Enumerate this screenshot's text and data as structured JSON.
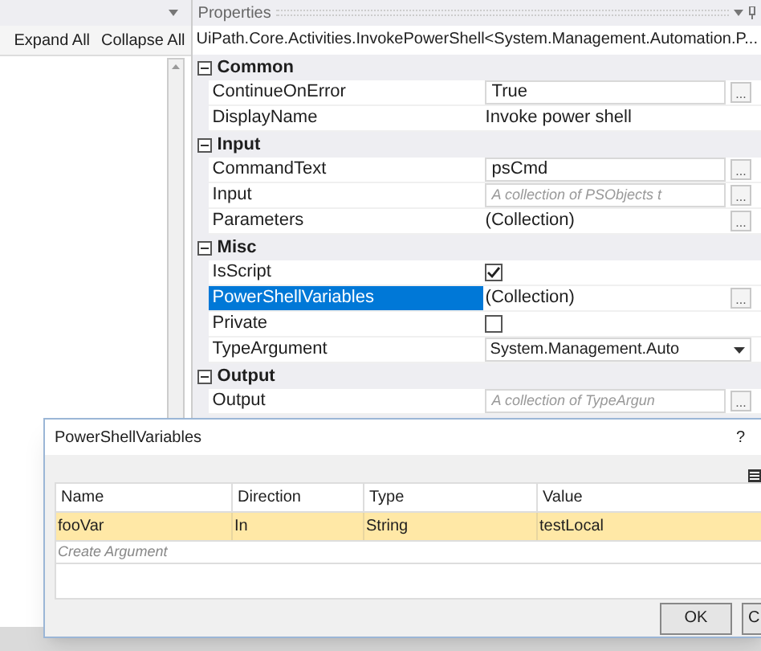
{
  "outline": {
    "actions": [
      "Expand All",
      "Collapse All"
    ]
  },
  "properties": {
    "title": "Properties",
    "type_name": "UiPath.Core.Activities.InvokePowerShell<System.Management.Automation.P...",
    "groups": [
      {
        "name": "Common",
        "rows": [
          {
            "name": "ContinueOnError",
            "kind": "text",
            "value": "True",
            "button": "...",
            "selected": false
          },
          {
            "name": "DisplayName",
            "kind": "plain",
            "value": "Invoke power shell",
            "selected": false
          }
        ]
      },
      {
        "name": "Input",
        "rows": [
          {
            "name": "CommandText",
            "kind": "text",
            "value": "psCmd",
            "button": "...",
            "selected": false
          },
          {
            "name": "Input",
            "kind": "placeholder",
            "placeholder": "A collection of PSObjects t",
            "button": "...",
            "selected": false
          },
          {
            "name": "Parameters",
            "kind": "plain",
            "value": "(Collection)",
            "button": "...",
            "selected": false
          }
        ]
      },
      {
        "name": "Misc",
        "rows": [
          {
            "name": "IsScript",
            "kind": "check",
            "checked": true,
            "selected": false
          },
          {
            "name": "PowerShellVariables",
            "kind": "plain",
            "value": "(Collection)",
            "button": "...",
            "selected": true
          },
          {
            "name": "Private",
            "kind": "check",
            "checked": false,
            "selected": false
          },
          {
            "name": "TypeArgument",
            "kind": "dropdown",
            "value": "System.Management.Auto",
            "selected": false
          }
        ]
      },
      {
        "name": "Output",
        "rows": [
          {
            "name": "Output",
            "kind": "placeholder",
            "placeholder": "A collection of TypeArgun",
            "button": "...",
            "selected": false
          }
        ]
      }
    ]
  },
  "dialog": {
    "title": "PowerShellVariables",
    "help": "?",
    "columns": [
      "Name",
      "Direction",
      "Type",
      "Value"
    ],
    "rows": [
      {
        "cells": [
          "fooVar",
          "In",
          "String",
          "testLocal"
        ],
        "selected": true
      }
    ],
    "create_placeholder": "Create Argument",
    "buttons": [
      "OK",
      "C"
    ]
  }
}
